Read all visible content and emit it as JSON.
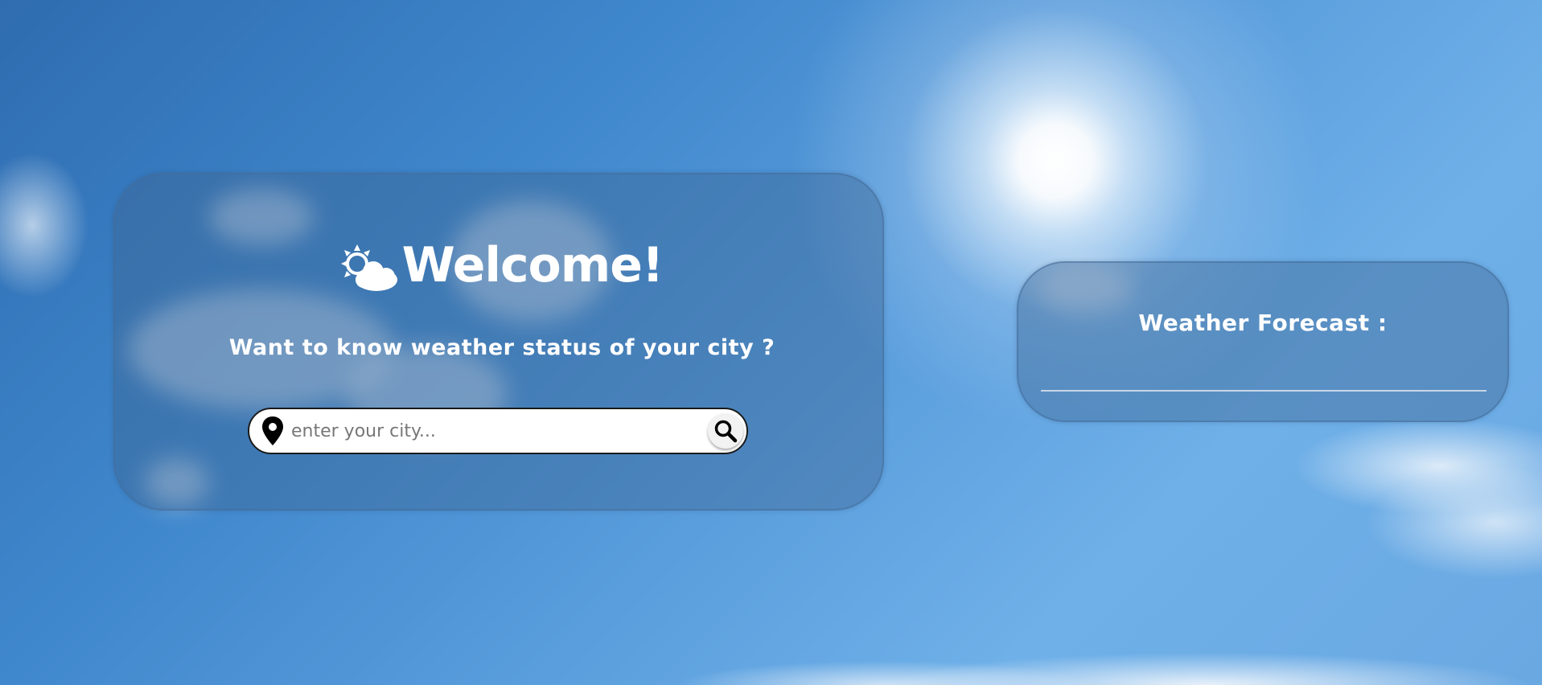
{
  "welcome": {
    "icon": "sun-cloud-icon",
    "title": "Welcome!",
    "subtitle": "Want to know weather status of your city ?",
    "search": {
      "placeholder": "enter your city...",
      "value": "",
      "location_icon": "location-pin-icon",
      "button_icon": "search-icon"
    }
  },
  "forecast": {
    "title": "Weather Forecast :"
  },
  "colors": {
    "card_background": "#3c6491",
    "text": "#ffffff",
    "search_background": "#ffffff",
    "search_border": "#1a1a1a"
  }
}
